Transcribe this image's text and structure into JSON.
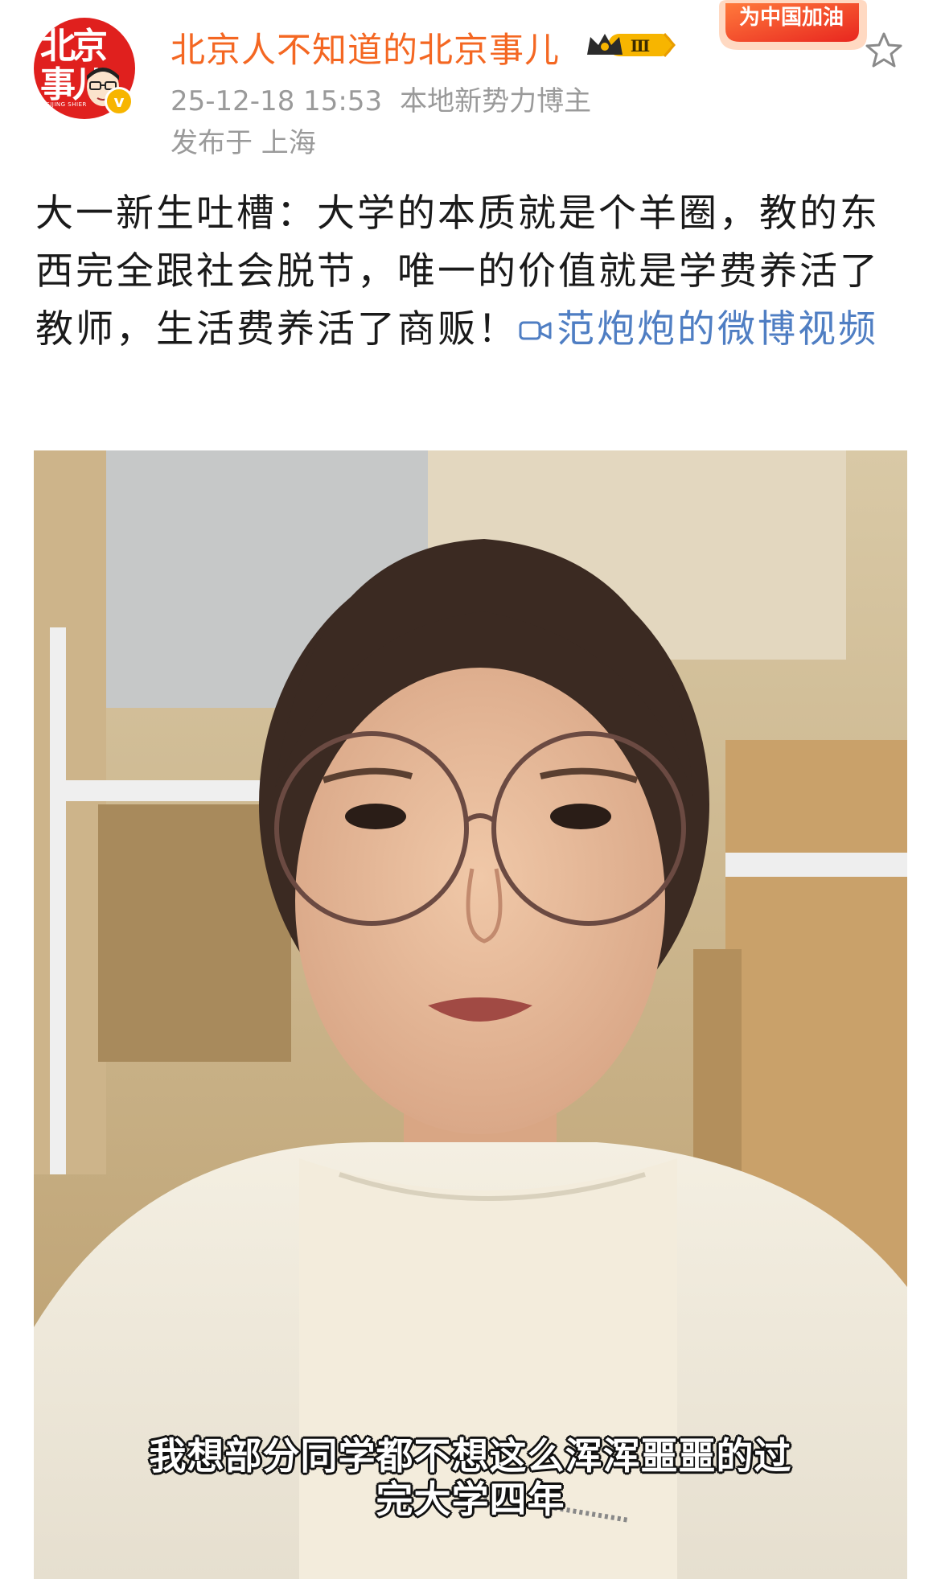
{
  "author": {
    "name": "北京人不知道的北京事儿",
    "avatar_logo": "北京事儿",
    "avatar_logo_sub": "BEIJING SHIER",
    "verified_mark": "v",
    "level": "Ⅲ"
  },
  "promo_banner": {
    "text": "为中国加油"
  },
  "post_meta": {
    "timestamp": "25-12-18 15:53",
    "role": "本地新势力博主",
    "location": "发布于 上海"
  },
  "post": {
    "text": "大一新生吐槽：大学的本质就是个羊圈，教的东西完全跟社会脱节，唯一的价值就是学费养活了教师，生活费养活了商贩！",
    "video_link_label": "范炮炮的微博视频"
  },
  "video": {
    "subtitle_line1": "我想部分同学都不想这么浑浑噩噩的过",
    "subtitle_line2": "完大学四年"
  },
  "icons": {
    "star": "star-icon",
    "video_link": "video-camera-icon",
    "level_badge": "crown-icon"
  },
  "colors": {
    "author_name": "#f46722",
    "link": "#4f7ec3",
    "meta": "#9a9a9a",
    "avatar_bg": "#e0201e",
    "verified": "#f7b500"
  }
}
